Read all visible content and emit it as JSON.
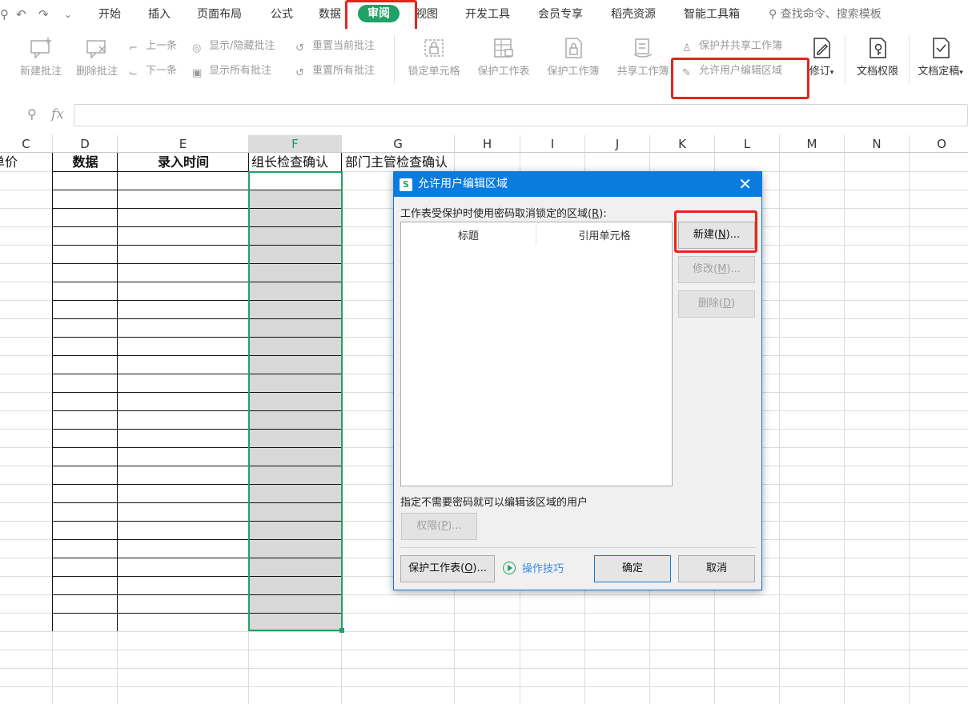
{
  "menubar": {
    "tabs": [
      "开始",
      "插入",
      "页面布局",
      "公式",
      "数据",
      "审阅",
      "视图",
      "开发工具",
      "会员专享",
      "稻壳资源",
      "智能工具箱"
    ],
    "active_tab": "审阅",
    "search_placeholder": "查找命令、搜索模板"
  },
  "ribbon": {
    "new_comment": "新建批注",
    "delete_comment": "删除批注",
    "prev": "上一条",
    "next": "下一条",
    "show_hide_comment": "显示/隐藏批注",
    "show_all_comments": "显示所有批注",
    "reset_current_comment": "重置当前批注",
    "reset_all_comments": "重置所有批注",
    "lock_cells": "锁定单元格",
    "protect_sheet": "保护工作表",
    "protect_workbook": "保护工作簿",
    "share_workbook": "共享工作簿",
    "protect_share_workbook": "保护并共享工作簿",
    "allow_edit_ranges": "允许用户编辑区域",
    "revise": "修订",
    "doc_permission": "文档权限",
    "doc_finalize": "文档定稿"
  },
  "formula_bar": {
    "fx": "fx",
    "value": ""
  },
  "columns": [
    "C",
    "D",
    "E",
    "F",
    "G",
    "H",
    "I",
    "J",
    "K",
    "L",
    "M",
    "N",
    "O"
  ],
  "selected_column": "F",
  "row1": {
    "c": "单价",
    "d": "数据",
    "e": "录入时间",
    "f": "组长检查确认",
    "g": "部门主管检查确认"
  },
  "dialog": {
    "title": "允许用户编辑区域",
    "app_badge": "S",
    "ranges_label": "工作表受保护时使用密码取消锁定的区域(R):",
    "col_title": "标题",
    "col_ref": "引用单元格",
    "new_button": "新建(N)...",
    "modify_button": "修改(M)...",
    "delete_button": "删除(D)",
    "users_label": "指定不需要密码就可以编辑该区域的用户",
    "permission_button": "权限(P)...",
    "protect_sheet_button": "保护工作表(O)...",
    "tips": "操作技巧",
    "ok": "确定",
    "cancel": "取消"
  },
  "colors": {
    "accent_green": "#1fa167",
    "dialog_blue": "#0a7ce0",
    "highlight_red": "#e8241c",
    "selection_gray": "#d8d8d8"
  }
}
